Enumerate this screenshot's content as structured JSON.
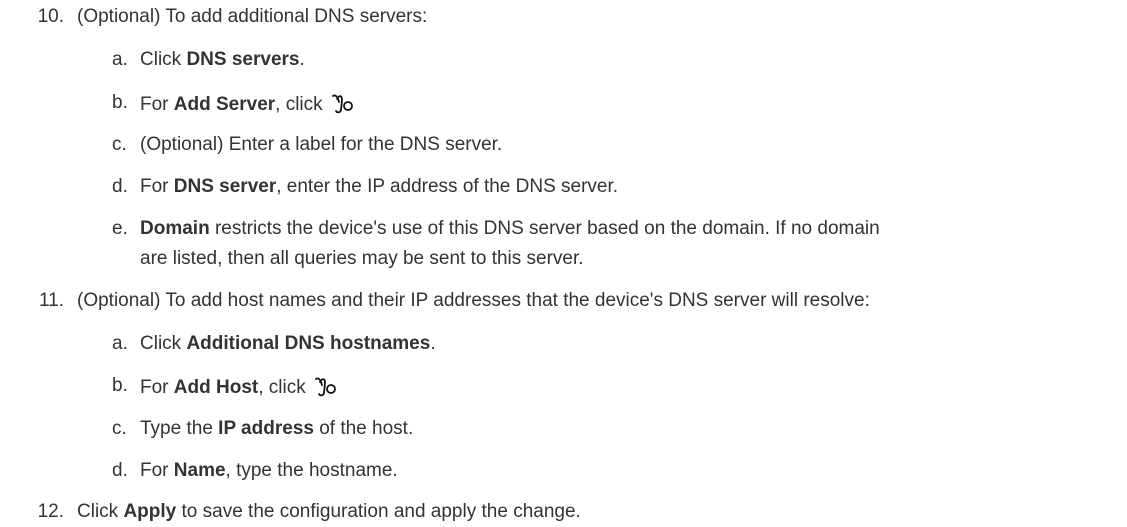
{
  "steps": [
    {
      "num": "10.",
      "text": "(Optional) To add additional DNS servers:",
      "sub": [
        {
          "letter": "a.",
          "pre": "Click ",
          "bold": "DNS servers",
          "post": "."
        },
        {
          "letter": "b.",
          "pre": "For ",
          "bold": "Add Server",
          "post": ", click ",
          "icon": "add-icon"
        },
        {
          "letter": "c.",
          "pre": "(Optional) Enter a label for the DNS server.",
          "bold": "",
          "post": ""
        },
        {
          "letter": "d.",
          "pre": "For ",
          "bold": "DNS server",
          "post": ", enter the IP address of the DNS server."
        },
        {
          "letter": "e.",
          "pre": "",
          "bold": "Domain",
          "post": " restricts the device's use of this DNS server based on the domain. If no domain",
          "cont": "are listed, then all queries may be sent to this server."
        }
      ]
    },
    {
      "num": "11.",
      "text": "(Optional) To add host names and their IP addresses that the device's DNS server will resolve:",
      "sub": [
        {
          "letter": "a.",
          "pre": "Click ",
          "bold": "Additional DNS hostnames",
          "post": "."
        },
        {
          "letter": "b.",
          "pre": "For ",
          "bold": "Add Host",
          "post": ", click ",
          "icon": "add-icon"
        },
        {
          "letter": "c.",
          "pre": "Type the ",
          "bold": "IP address",
          "post": " of the host."
        },
        {
          "letter": "d.",
          "pre": "For ",
          "bold": "Name",
          "post": ", type the hostname."
        }
      ]
    },
    {
      "num": "12.",
      "pre": "Click ",
      "bold": "Apply",
      "post": " to save the configuration and apply the change."
    }
  ]
}
